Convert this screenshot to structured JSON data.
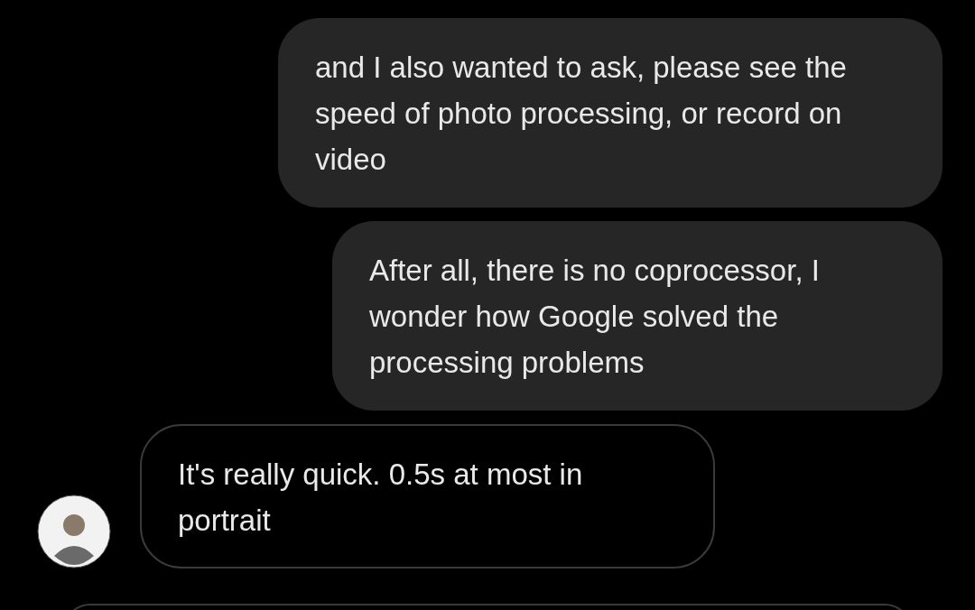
{
  "messages": [
    {
      "kind": "outgoing",
      "text": "and I also wanted to ask, please see the speed of photo processing, or record on video"
    },
    {
      "kind": "outgoing",
      "text": "After all, there is no coprocessor, I wonder how Google solved the processing problems"
    },
    {
      "kind": "incoming",
      "text": "It's really quick. 0.5s at most in portrait"
    }
  ]
}
